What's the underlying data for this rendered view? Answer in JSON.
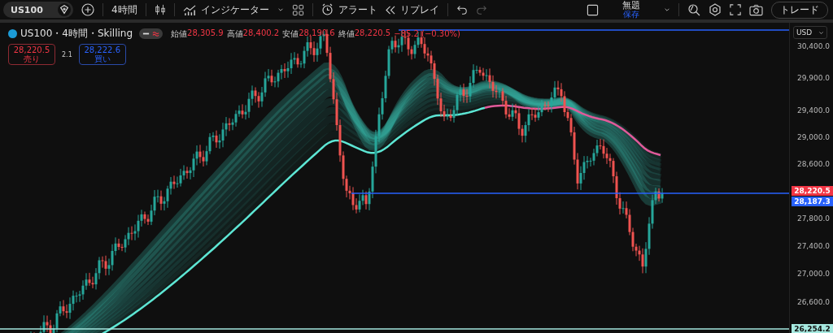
{
  "toolbar": {
    "symbol": "US100",
    "interval": "4時間",
    "indicators": "インジケーター",
    "alert": "アラート",
    "replay": "リプレイ",
    "layout": {
      "title": "無題",
      "save": "保存"
    },
    "trade": "トレード"
  },
  "legend": {
    "title": "US100・4時間・Skilling",
    "ohlc": [
      {
        "label": "始値",
        "value": "28,305.9"
      },
      {
        "label": "高値",
        "value": "28,400.2"
      },
      {
        "label": "安値",
        "value": "28,190.6"
      },
      {
        "label": "終値",
        "value": "28,220.5"
      }
    ],
    "change": "−85.2 (−0.30%)",
    "sell": {
      "price": "28,220.5",
      "label": "売り"
    },
    "spread": "2.1",
    "buy": {
      "price": "28,222.6",
      "label": "買い"
    }
  },
  "price_axis": {
    "currency": "USD",
    "ticks": [
      "30,400.0",
      "29,900.0",
      "29,400.0",
      "29,000.0",
      "28,600.0",
      "27,800.0",
      "27,400.0",
      "27,000.0",
      "26,600.0"
    ],
    "tags": [
      {
        "text": "28,220.5",
        "color": "#f23645"
      },
      {
        "text": "28,187.3",
        "color": "#2962ff"
      },
      {
        "text": "26,254.2",
        "color": "#a6e9e0"
      }
    ]
  }
}
